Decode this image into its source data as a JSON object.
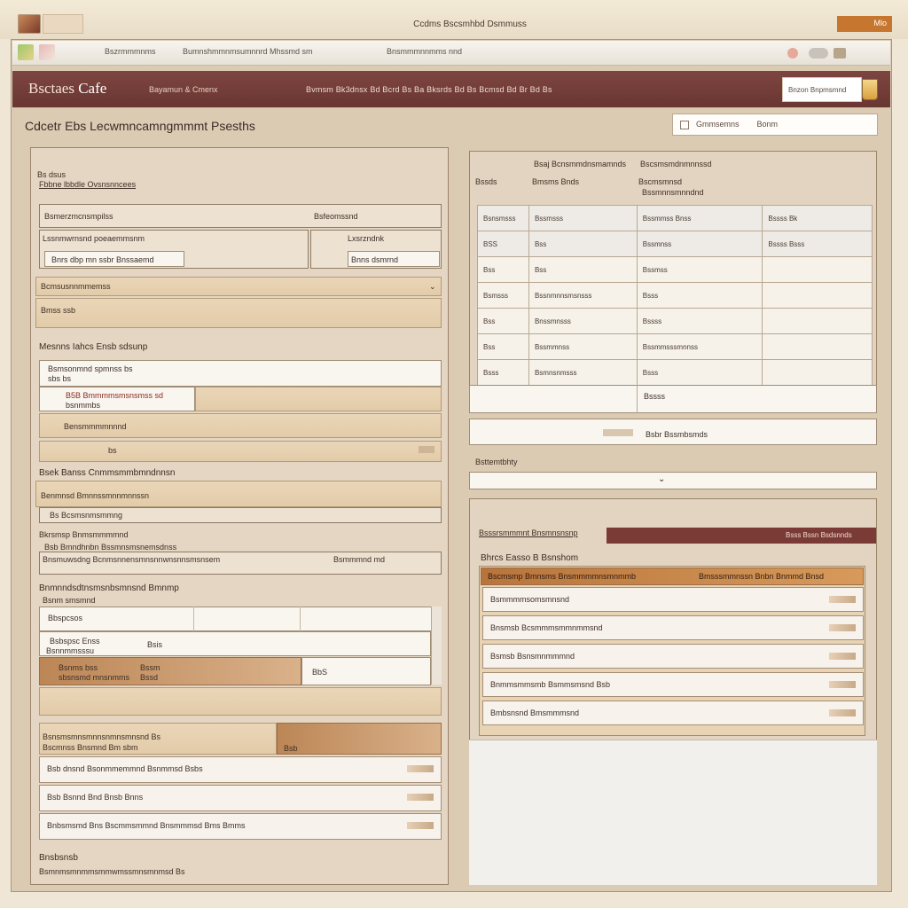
{
  "window": {
    "title": "Ccdms Bscsmhbd Dsmmuss",
    "badge": "Mlo",
    "app_icon_label": ""
  },
  "toolbar": {
    "left_text": "Bszrmmmnms",
    "mid_text": "Bumnshmmnmsumnnrd  Mhssmd  sm",
    "right_text": "Bnsmmmnnmms  nnd"
  },
  "header": {
    "brand_main": "Bsctaes",
    "brand_accent": "Cafe",
    "sub": "Bayamun & Cmenx",
    "nav": "Bvmsm  Bk3dnsx  Bd  Bcrd  Bs  Ba  Bksrds  Bd  Bs  Bcmsd  Bd  Br  Bd  Bs",
    "search_value": "Bnzon   Bnpmsmnd"
  },
  "page": {
    "title": "Cdcetr  Ebs  Lecwmncamngmmmt  Psesths"
  },
  "top_search": {
    "placeholder": "Gmmsemns",
    "value": "Bonm"
  },
  "left": {
    "s1_hint": "Bs  dsus",
    "s1_title": "Fbbne lbbdle  Ovsnsnncees",
    "f1_label": "Bsmerzmcnsmpilss",
    "f1_value": "Bsfeomssnd",
    "f2_label": "Lssnmwrnsnd  poeaemmsnm",
    "f2_sub": "Bnrs  dbp  mn  ssbr  Bnssaemd",
    "f2_right_label": "Lxsrzndnk",
    "f2_right_value": "Bnns  dsmrnd",
    "s2_label": "Bcmsusnnmmemss",
    "s2_value": "Bmss  ssb",
    "s3_title": "Mesnns  Iahcs  Ensb  sdsunp",
    "row1_a": "Bsmsonmnd  spmnss  bs",
    "row1_b": "sbs  bs",
    "row2_a": "B5B  Bmmmmsmsnsmss  sd",
    "row2_b": "bsnmmbs",
    "row3": "Bensmmmmnnnd",
    "row4": "bs",
    "s4_title": "Bsek  Banss  Cnmmsmmbmndnnsn",
    "s4_sub": "Benmnsd  Bmnnssmnnmnnssn",
    "s4_field": "Bs  Bcsmsnmsmmng",
    "s5_label": "Bkrsmsp   Bnmsmmmmnd",
    "s5_a": "Bsb  Bmndhnbn  Bssmnsmsnemsdnss",
    "s5_b": "Bnsmuwsdng  Bcnmsnnensmnsnnwnsnnsmsnsem",
    "s5_c": "Bsmmmnd  md",
    "s6_title": "Bnmnndsdtnsmsnbsmnsnd  Bmnmp",
    "s6_sub": "Bsnm  smsmnd",
    "t_row1": "Bbspcsos",
    "t_row2_a": "Bsbspsc  Enss",
    "t_row2_b": "Bsnnmmsssu",
    "t_row2_c": "Bsis",
    "t_row3_a": "Bsnms  bss",
    "t_row3_b": "sbsnsmd  mnsnmms",
    "t_row3_c": "Bssm",
    "t_row3_d": "Bssd",
    "t_row3_e": "BbS",
    "b1_a": "Bsnsmsmnsmnnsnmnsmnsnd  Bs",
    "b1_b": "Bscmnss  Bnsmnd  Bm  sbm",
    "b1_right": "Bsb",
    "l1": "Bsb  dnsnd   Bsonmmemmnd  Bsnmmsd  Bsbs",
    "l2": "Bsb  Bsnnd     Bnd  Bnsb  Bnns",
    "l3": "Bnbsmsmd  Bns      Bscmmsmmnd  Bnsmmmsd     Bms  Bmms",
    "foot_title": "Bnsbsnsb",
    "foot_sub": "Bsmnmsmnmmsmmwmssmnsmnmsd  Bs"
  },
  "right_table": {
    "head1": "Bsaj  Bcnsmmdnsmamnds",
    "head2": "Bscsmsmdnmnnssd",
    "col_a": "Bssds",
    "col_b": "Bmsms  Bnds",
    "col_c": "Bscmsmnsd",
    "col_c_sub": "Bssmnnsmnndnd",
    "rows": [
      [
        "Bsnsmsss",
        "Bssmsss",
        "Bssmmss  Bnss",
        "Bssss  Bk"
      ],
      [
        "BSS",
        "Bss",
        "Bssmnss",
        "Bssss  Bsss"
      ],
      [
        "Bss",
        "Bss",
        "Bssmss",
        ""
      ],
      [
        "Bsmsss",
        "Bssnmnnsmsnsss",
        "Bsss",
        ""
      ],
      [
        "Bss",
        "Bnssmnsss",
        "Bssss",
        ""
      ],
      [
        "Bss",
        "Bssmmnss",
        "Bssmmsssmnnss",
        ""
      ],
      [
        "Bsss",
        "Bsmnsnmsss",
        "Bsss",
        ""
      ]
    ],
    "total": "Bssss",
    "under_label": "Bsbr  Bssmbsmds",
    "sub_label": "Bsttemtbhty"
  },
  "right_bottom": {
    "bar_label": "Bsssrsmmmnt  Bnsmnsnsnp",
    "bar_right": "Bsss  Bssn  Bsdsnnds",
    "sub_title": "Bhrcs  Easso  B  Bsnshom",
    "header_left": "Bscmsmp  Bmnsms  Bnsmmmmnsmnmmb",
    "header_right": "Bmsssmmnssn  Bnbn  Bnmmd  Bnsd",
    "items": [
      "Bsmmmmsomsmnsnd",
      "Bnsmsb  Bcsmmmsmmnmmsnd",
      "Bsmsb  Bsnsmnmmmnd",
      "Bnmmsmmsmb  Bsmmsmsnd  Bsb",
      "Bmbsnsnd  Bmsmmmsnd"
    ]
  },
  "colors": {
    "header": "#6f3a36",
    "accent": "#c6762e",
    "panel": "#e4d6c2",
    "frame": "#dccbb3"
  }
}
